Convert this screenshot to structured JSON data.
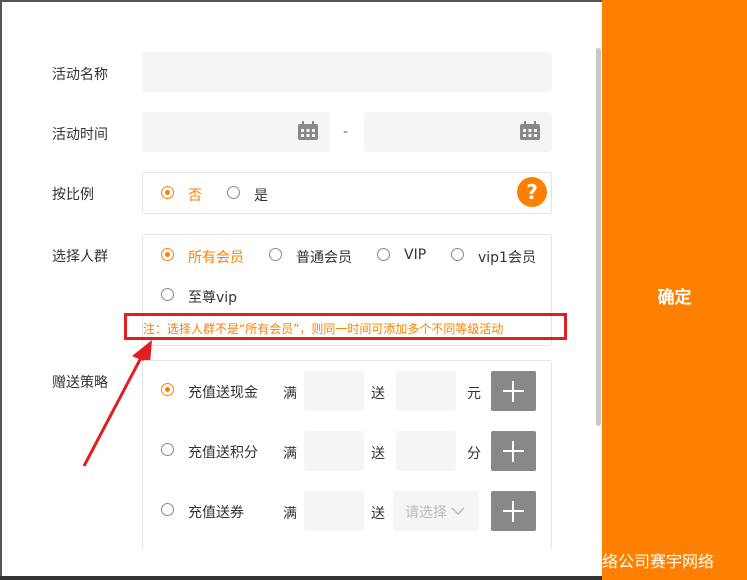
{
  "form": {
    "activity_name_label": "活动名称",
    "activity_time_label": "活动时间",
    "time_separator": "-",
    "ratio_label": "按比例",
    "ratio_options": [
      "否",
      "是"
    ],
    "help_symbol": "?",
    "crowd_label": "选择人群",
    "crowd_options": [
      "所有会员",
      "普通会员",
      "VIP",
      "vip1会员",
      "至尊vip"
    ],
    "note": "注：选择人群不是“所有会员”，则同一时间可添加多个不同等级活动",
    "strategy_label": "赠送策略",
    "strategies": [
      {
        "name": "充值送现金",
        "full": "满",
        "give": "送",
        "unit": "元"
      },
      {
        "name": "充值送积分",
        "full": "满",
        "give": "送",
        "unit": "分"
      },
      {
        "name": "充值送券",
        "full": "满",
        "give": "送",
        "select_placeholder": "请选择"
      }
    ]
  },
  "sidebar": {
    "confirm_label": "确定",
    "watermark": "络公司赛宇网络"
  },
  "colors": {
    "accent": "#ff8000",
    "annotation": "#e02020"
  }
}
